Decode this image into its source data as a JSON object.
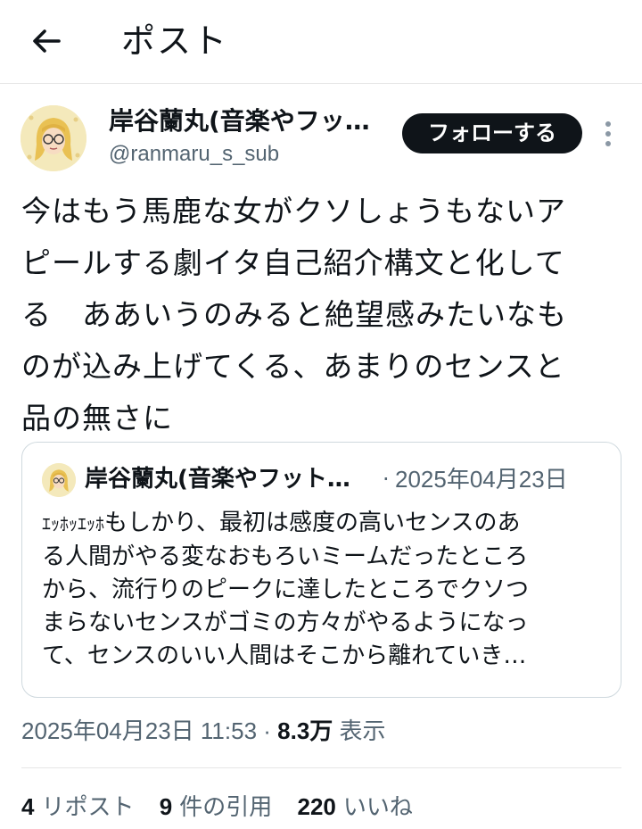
{
  "header": {
    "title": "ポスト",
    "back_icon": "arrow-left-icon"
  },
  "author": {
    "name": "岸谷蘭丸(音楽やフッ…",
    "handle": "@ranmaru_s_sub",
    "follow_label": "フォローする",
    "more_icon": "more-vertical-icon"
  },
  "post": {
    "lines": [
      "今はもう馬鹿な女がクソしょうもないア",
      "ピールする劇イタ自己紹介構文と化して",
      "る　ああいうのみると絶望感みたいなも",
      "のが込み上げてくる、あまりのセンスと",
      "品の無さに"
    ]
  },
  "quote": {
    "name": "岸谷蘭丸(音楽やフット…",
    "sep": "·",
    "date": "2025年04月23日",
    "first_prefix": "ｴｯﾎｯｴｯﾎ",
    "first_rest": "もしかり、最初は感度の高いセンスのあ",
    "lines": [
      "る人間がやる変なおもろいミームだったところ",
      "から、流行りのピークに達したところでクソつ",
      "まらないセンスがゴミの方々がやるようになっ",
      "て、センスのいい人間はそこから離れていき…"
    ]
  },
  "meta": {
    "datetime": "2025年04月23日 11:53 · ",
    "views_count": "8.3万",
    "views_label": " 表示"
  },
  "stats": {
    "reposts_count": "4",
    "reposts_label": "リポスト",
    "quotes_count": "9",
    "quotes_label": "件の引用",
    "likes_count": "220",
    "likes_label": "いいね"
  },
  "colors": {
    "text": "#0f1419",
    "muted": "#536471",
    "border": "#cfd9de",
    "follow_bg": "#0f1419"
  }
}
